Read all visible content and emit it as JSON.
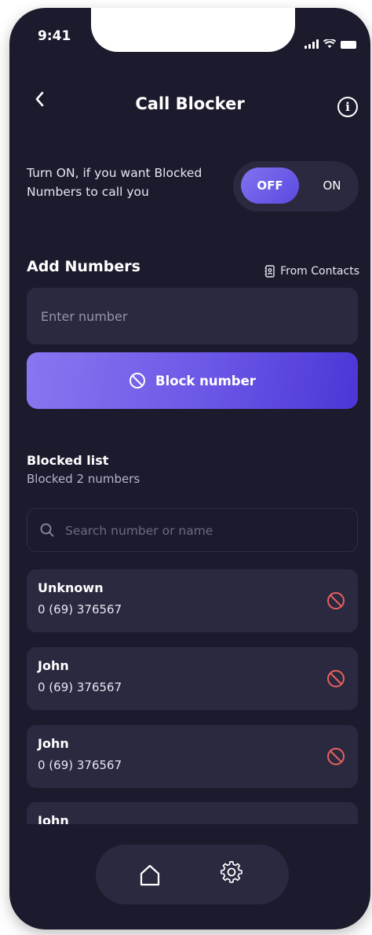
{
  "status_bar": {
    "time": "9:41"
  },
  "header": {
    "title": "Call Blocker",
    "info_icon": "info-icon",
    "back_icon": "chevron-left-icon"
  },
  "toggle": {
    "description": "Turn ON, if you want Blocked Numbers to call you",
    "off_label": "OFF",
    "on_label": "ON",
    "selected": "OFF"
  },
  "add_numbers": {
    "title": "Add Numbers",
    "from_contacts": "From Contacts",
    "input_placeholder": "Enter number",
    "input_value": "",
    "block_button": "Block number"
  },
  "blocked_list": {
    "title": "Blocked list",
    "subtitle": "Blocked 2 numbers",
    "search_placeholder": "Search number or name",
    "items": [
      {
        "name": "Unknown",
        "number": "0 (69) 376567"
      },
      {
        "name": "John",
        "number": "0 (69) 376567"
      },
      {
        "name": "John",
        "number": "0 (69) 376567"
      },
      {
        "name": "John",
        "number": ""
      }
    ]
  },
  "bottom_nav": {
    "items": [
      "home-icon",
      "settings-icon"
    ]
  },
  "colors": {
    "background": "#1c1b2e",
    "surface": "#2a293f",
    "accent": "#6a57e6",
    "unblock": "#e8605e"
  }
}
